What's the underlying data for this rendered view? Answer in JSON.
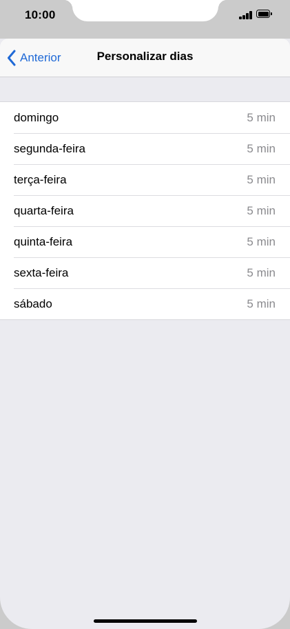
{
  "status_bar": {
    "time": "10:00",
    "signal_icon": "cellular-signal-icon",
    "battery_icon": "battery-icon"
  },
  "nav": {
    "back_label": "Anterior",
    "back_icon": "chevron-left-icon",
    "title": "Personalizar dias"
  },
  "days": [
    {
      "label": "domingo",
      "value": "5 min"
    },
    {
      "label": "segunda-feira",
      "value": "5 min"
    },
    {
      "label": "terça-feira",
      "value": "5 min"
    },
    {
      "label": "quarta-feira",
      "value": "5 min"
    },
    {
      "label": "quinta-feira",
      "value": "5 min"
    },
    {
      "label": "sexta-feira",
      "value": "5 min"
    },
    {
      "label": "sábado",
      "value": "5 min"
    }
  ],
  "colors": {
    "accent": "#1f69d6",
    "grouped_background": "#ebebf0",
    "secondary_text": "#8a8a8e"
  }
}
